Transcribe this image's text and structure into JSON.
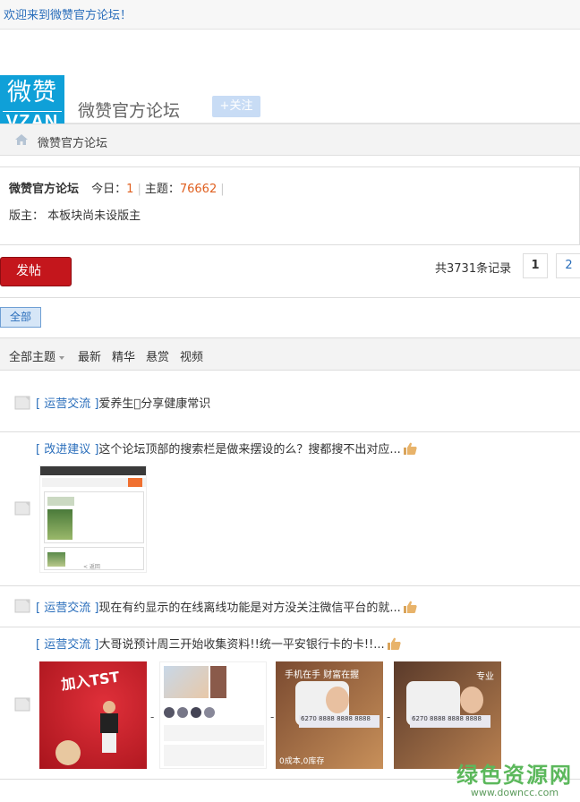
{
  "welcome": "欢迎来到微赞官方论坛！",
  "logo": {
    "cn": "微赞",
    "en": "VZAN"
  },
  "forum_title": "微赞官方论坛",
  "follow_label": "+关注",
  "breadcrumb": {
    "label": "微赞官方论坛",
    "icon": "home-icon"
  },
  "info": {
    "name": "微赞官方论坛",
    "today_label": "今日：",
    "today_value": "1",
    "topics_label": "主题：",
    "topics_value": "76662",
    "moderator": "版主： 本板块尚未设版主"
  },
  "post_button": "发帖",
  "pagination": {
    "record_text": "共3731条记录",
    "pages": [
      "1",
      "2"
    ]
  },
  "tag_all": "全部",
  "filters": {
    "all_topics": "全部主题",
    "latest": "最新",
    "featured": "精华",
    "reward": "悬赏",
    "video": "视频"
  },
  "threads": [
    {
      "category": "[ 运营交流 ]",
      "title": "爱养生\u0000分享健康常识"
    },
    {
      "category": "[ 改进建议 ]",
      "title": "这个论坛顶部的搜索栏是做来摆设的么？搜都搜不出对应..."
    },
    {
      "category": "[ 运营交流 ]",
      "title": "现在有约显示的在线离线功能是对方没关注微信平台的就..."
    },
    {
      "category": "[ 运营交流 ]",
      "title": "大哥说预计周三开始收集资料!!统一平安银行卡的卡!!..."
    }
  ],
  "thread_images": {
    "t2_caption": "< 返回",
    "t4_img1_text": "加入TST",
    "t4_img3_text": "手机在手 财富在握",
    "t4_img3_bottom": "0成本,0库存",
    "card_number": "6270 8888 8888 8888",
    "t4_img4_text": "专业"
  },
  "image_separator": "-",
  "watermark": {
    "cn": "绿色资源网",
    "en": "www.downcc.com"
  },
  "colors": {
    "accent_blue": "#2a6ebb",
    "post_red": "#c4161c",
    "number_orange": "#e06020",
    "logo_blue": "#0fa0d8"
  }
}
